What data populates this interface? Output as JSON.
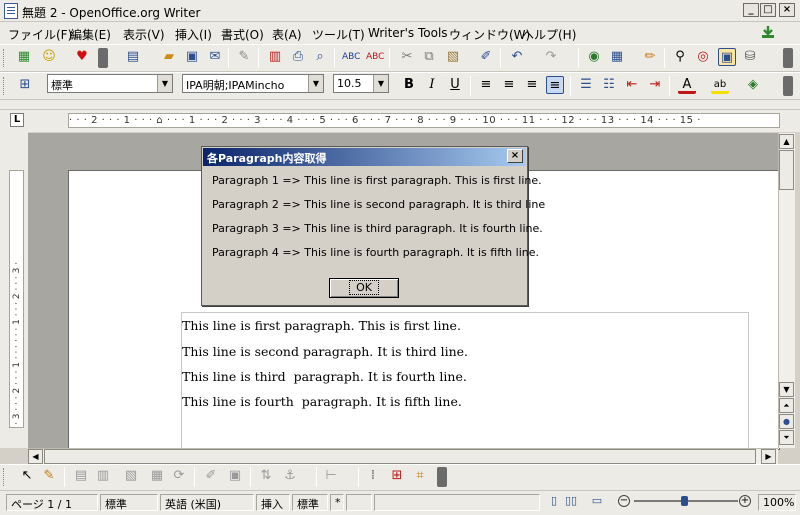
{
  "window": {
    "title": "無題 2 - OpenOffice.org Writer",
    "minimize": "_",
    "maximize": "□",
    "close": "×"
  },
  "menu": [
    "ファイル(F)",
    "編集(E)",
    "表示(V)",
    "挿入(I)",
    "書式(O)",
    "表(A)",
    "ツール(T)",
    "Writer's Tools",
    "ウィンドウ(W)",
    "ヘルプ(H)"
  ],
  "formatting": {
    "style": "標準",
    "font": "IPA明朝;IPAMincho",
    "size": "10.5",
    "bold": "B",
    "italic": "I",
    "underline": "U",
    "font_color_glyph": "A",
    "highlight_glyph": "ab"
  },
  "ruler": {
    "top": "· · · 2 · · · 1 · · · ⌂ · · · 1 · · · 2 · · · 3 · · · 4 · · · 5 · · · 6 · · · 7 · · · 8 · · · 9 · · · 10 · · · 11 · · · 12 · · · 13 · · · 14 · · · 15 ·",
    "left": "· 3 · · · 2 · · · 1 · · · · · · 1 · · · 2 · · · 3 ·"
  },
  "document": {
    "lines": [
      "This line is first paragraph. This is first line.",
      "This line is second paragraph. It is third line.",
      "This line is third  paragraph. It is fourth line.",
      "This line is fourth  paragraph. It is fifth line."
    ]
  },
  "dialog": {
    "title": "各Paragraph内容取得",
    "close": "×",
    "lines": [
      "Paragraph 1 => This line is first paragraph. This is first line.",
      "Paragraph 2 => This line is second paragraph. It is third line",
      "Paragraph 3 => This line is third  paragraph. It is fourth line.",
      "Paragraph 4 => This line is fourth  paragraph. It is fifth line."
    ],
    "ok": "OK"
  },
  "status": {
    "page": "ページ 1 / 1",
    "style": "標準",
    "language": "英語 (米国)",
    "insert_mode": "挿入",
    "selection_mode": "標準",
    "modified": "*",
    "zoom": "100%"
  },
  "icons": {
    "toolbar": [
      "new-doc-icon",
      "smiley-icon",
      "heart-icon",
      "new-icon",
      "open-icon",
      "save-icon",
      "mail-icon",
      "edit-icon",
      "pdf-icon",
      "print-icon",
      "preview-icon",
      "spellcheck-icon",
      "autospell-icon",
      "cut-icon",
      "copy-icon",
      "paste-icon",
      "format-paint-icon",
      "undo-icon",
      "redo-icon",
      "navigator-icon",
      "table-icon",
      "draw-icon",
      "find-icon",
      "gallery-icon",
      "datasource-icon",
      "zoom-icon"
    ]
  }
}
